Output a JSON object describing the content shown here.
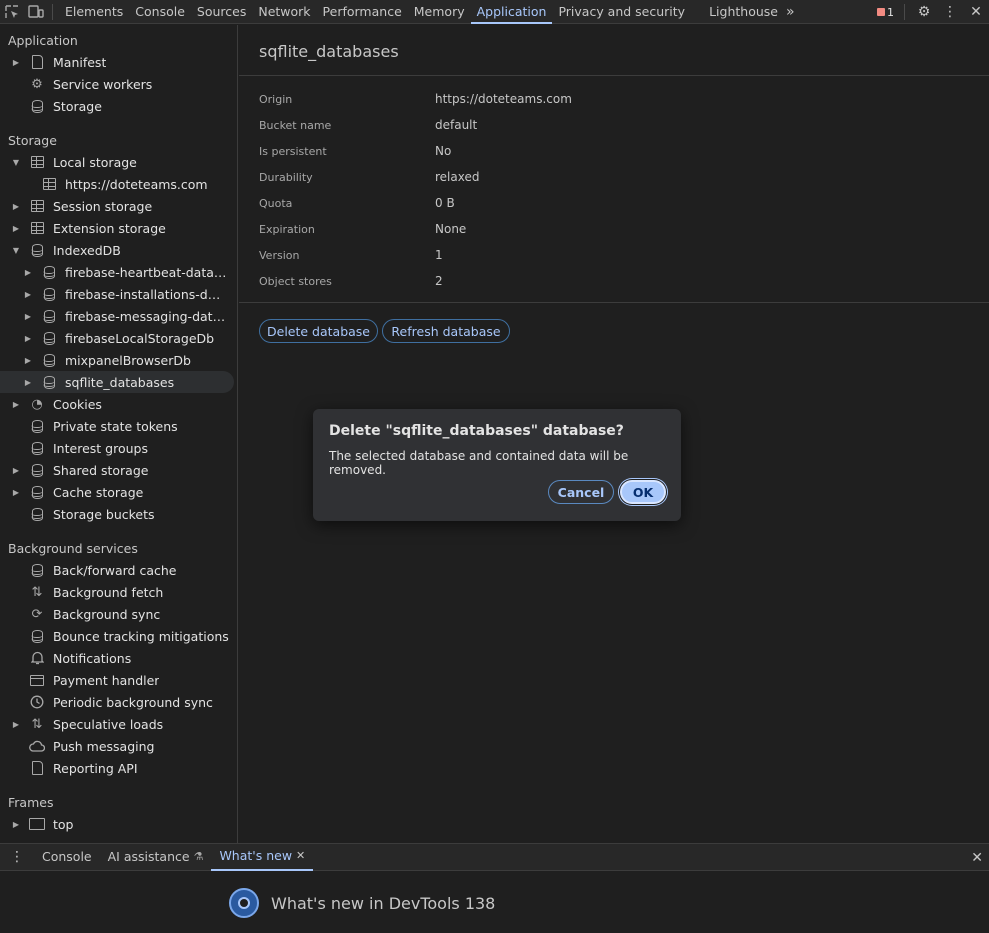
{
  "toolbar": {
    "tabs": [
      "Elements",
      "Console",
      "Sources",
      "Network",
      "Performance",
      "Memory",
      "Application",
      "Privacy and security",
      "Lighthouse"
    ],
    "active_tab": "Application",
    "more": "»",
    "issues_count": "1"
  },
  "sidebar": {
    "sections": {
      "application": "Application",
      "storage": "Storage",
      "background": "Background services",
      "frames": "Frames"
    },
    "application_items": [
      "Manifest",
      "Service workers",
      "Storage"
    ],
    "storage_items": {
      "local_storage": "Local storage",
      "local_origin": "https://doteteams.com",
      "session_storage": "Session storage",
      "extension_storage": "Extension storage",
      "indexeddb": "IndexedDB",
      "dbs": [
        "firebase-heartbeat-database",
        "firebase-installations-database",
        "firebase-messaging-database",
        "firebaseLocalStorageDb",
        "mixpanelBrowserDb",
        "sqflite_databases"
      ],
      "cookies": "Cookies",
      "private_state_tokens": "Private state tokens",
      "interest_groups": "Interest groups",
      "shared_storage": "Shared storage",
      "cache_storage": "Cache storage",
      "storage_buckets": "Storage buckets"
    },
    "background_items": [
      "Back/forward cache",
      "Background fetch",
      "Background sync",
      "Bounce tracking mitigations",
      "Notifications",
      "Payment handler",
      "Periodic background sync",
      "Speculative loads",
      "Push messaging",
      "Reporting API"
    ],
    "frames_items": [
      "top"
    ]
  },
  "main": {
    "title": "sqflite_databases",
    "fields": [
      {
        "key": "Origin",
        "value": "https://doteteams.com"
      },
      {
        "key": "Bucket name",
        "value": "default"
      },
      {
        "key": "Is persistent",
        "value": "No"
      },
      {
        "key": "Durability",
        "value": "relaxed"
      },
      {
        "key": "Quota",
        "value": "0 B"
      },
      {
        "key": "Expiration",
        "value": "None"
      },
      {
        "key": "Version",
        "value": "1"
      },
      {
        "key": "Object stores",
        "value": "2"
      }
    ],
    "delete_button": "Delete database",
    "refresh_button": "Refresh database"
  },
  "dialog": {
    "title": "Delete \"sqflite_databases\" database?",
    "message": "The selected database and contained data will be removed.",
    "cancel": "Cancel",
    "ok": "OK"
  },
  "drawer": {
    "tabs": [
      "Console",
      "AI assistance",
      "What's new"
    ],
    "active_tab": "What's new",
    "whats_new_title": "What's new in DevTools 138"
  }
}
